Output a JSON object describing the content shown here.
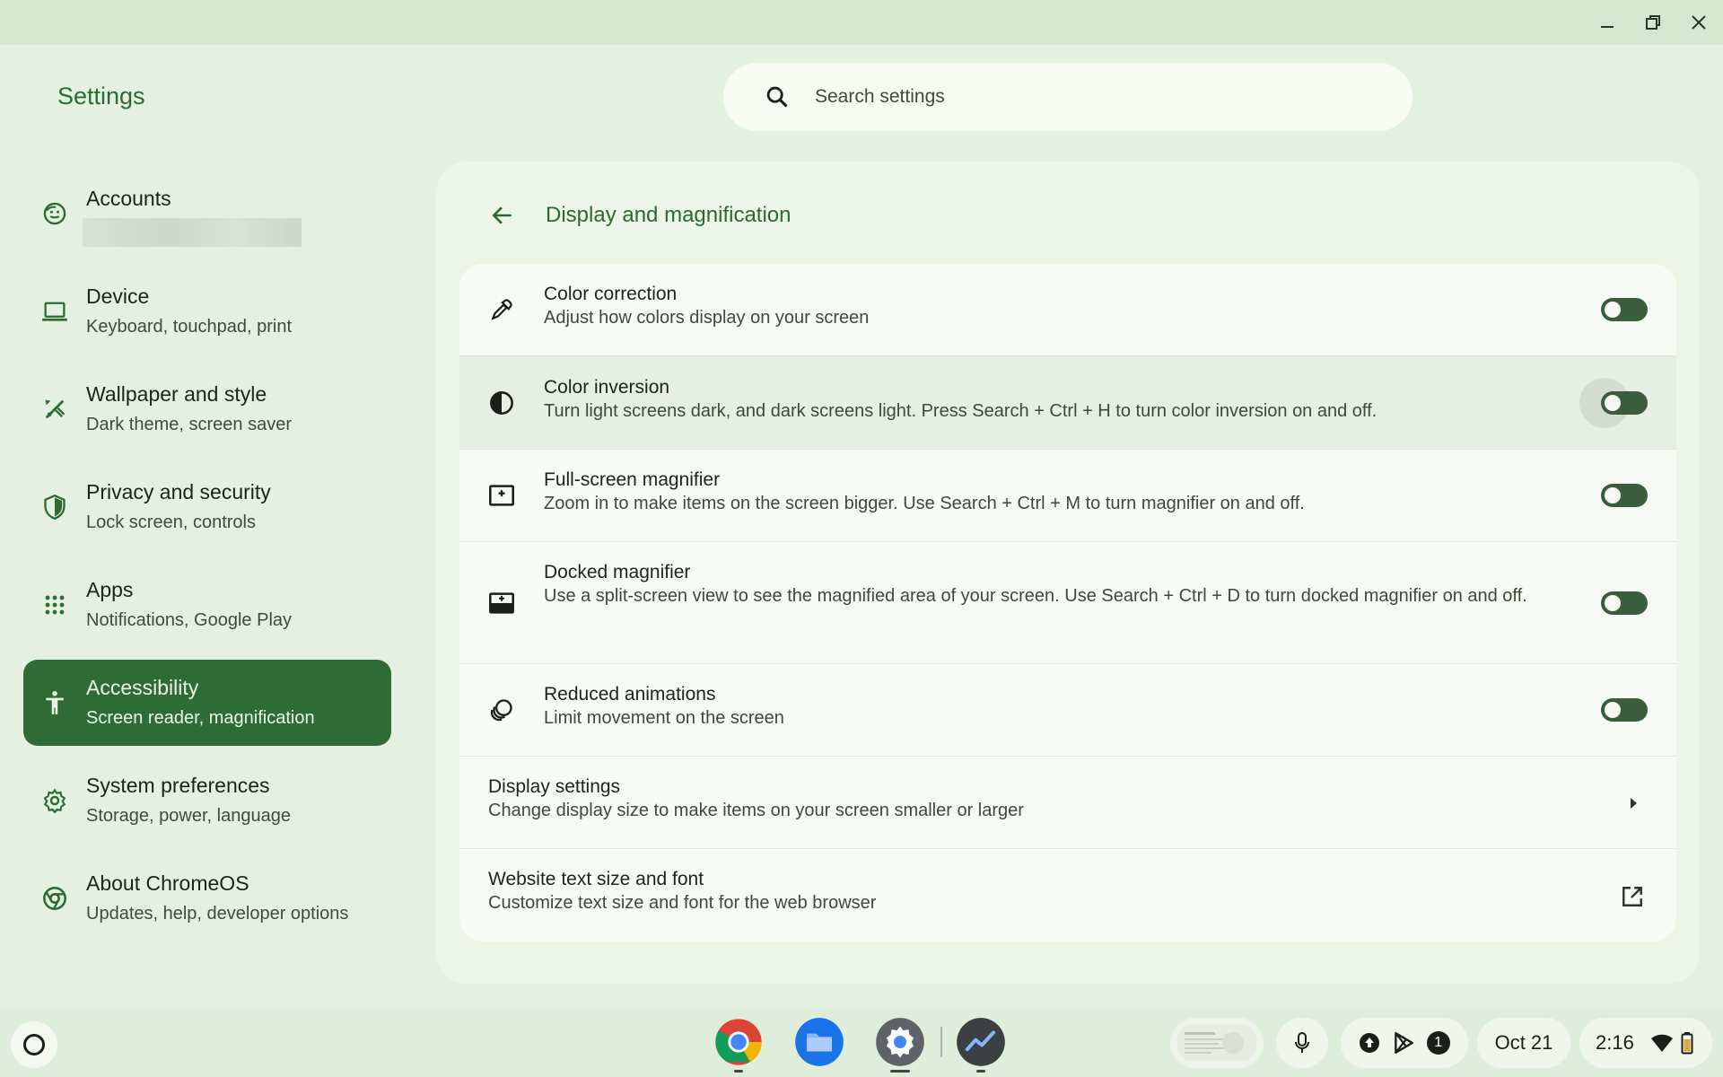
{
  "app": {
    "title": "Settings"
  },
  "search": {
    "placeholder": "Search settings"
  },
  "sidebar": {
    "items": [
      {
        "label": "Accounts",
        "sublabel": "",
        "icon": "account-icon"
      },
      {
        "label": "Device",
        "sublabel": "Keyboard, touchpad, print",
        "icon": "laptop-icon"
      },
      {
        "label": "Wallpaper and style",
        "sublabel": "Dark theme, screen saver",
        "icon": "palette-icon"
      },
      {
        "label": "Privacy and security",
        "sublabel": "Lock screen, controls",
        "icon": "shield-icon"
      },
      {
        "label": "Apps",
        "sublabel": "Notifications, Google Play",
        "icon": "apps-grid-icon"
      },
      {
        "label": "Accessibility",
        "sublabel": "Screen reader, magnification",
        "icon": "accessibility-icon",
        "active": true
      },
      {
        "label": "System preferences",
        "sublabel": "Storage, power, language",
        "icon": "gear-icon"
      },
      {
        "label": "About ChromeOS",
        "sublabel": "Updates, help, developer options",
        "icon": "chromeos-icon"
      }
    ]
  },
  "page": {
    "title": "Display and magnification"
  },
  "settings": {
    "rows": [
      {
        "title": "Color correction",
        "desc": "Adjust how colors display on your screen",
        "icon": "eyedropper-icon",
        "toggle": false
      },
      {
        "title": "Color inversion",
        "desc": "Turn light screens dark, and dark screens light. Press Search + Ctrl + H to turn color inversion on and off.",
        "icon": "contrast-icon",
        "toggle": false
      },
      {
        "title": "Full-screen magnifier",
        "desc": "Zoom in to make items on the screen bigger. Use Search + Ctrl + M to turn magnifier on and off.",
        "icon": "fullscreen-magnifier-icon",
        "toggle": false
      },
      {
        "title": "Docked magnifier",
        "desc": "Use a split-screen view to see the magnified area of your screen. Use Search + Ctrl + D to turn docked magnifier on and off.",
        "icon": "docked-magnifier-icon",
        "toggle": false
      },
      {
        "title": "Reduced animations",
        "desc": "Limit movement on the screen",
        "icon": "animation-icon",
        "toggle": false
      },
      {
        "title": "Display settings",
        "desc": "Change display size to make items on your screen smaller or larger",
        "icon": "chevron-right-icon"
      },
      {
        "title": "Website text size and font",
        "desc": "Customize text size and font for the web browser",
        "icon": "open-in-new-icon"
      }
    ]
  },
  "shelf": {
    "apps": [
      "chrome-icon",
      "files-icon",
      "settings-app-icon",
      "diagnostics-icon"
    ],
    "notification_count": "1",
    "date": "Oct 21",
    "time": "2:16"
  },
  "colors": {
    "accent": "#2f6c35",
    "background": "#e4f0e0",
    "card": "#f8fbf5"
  }
}
